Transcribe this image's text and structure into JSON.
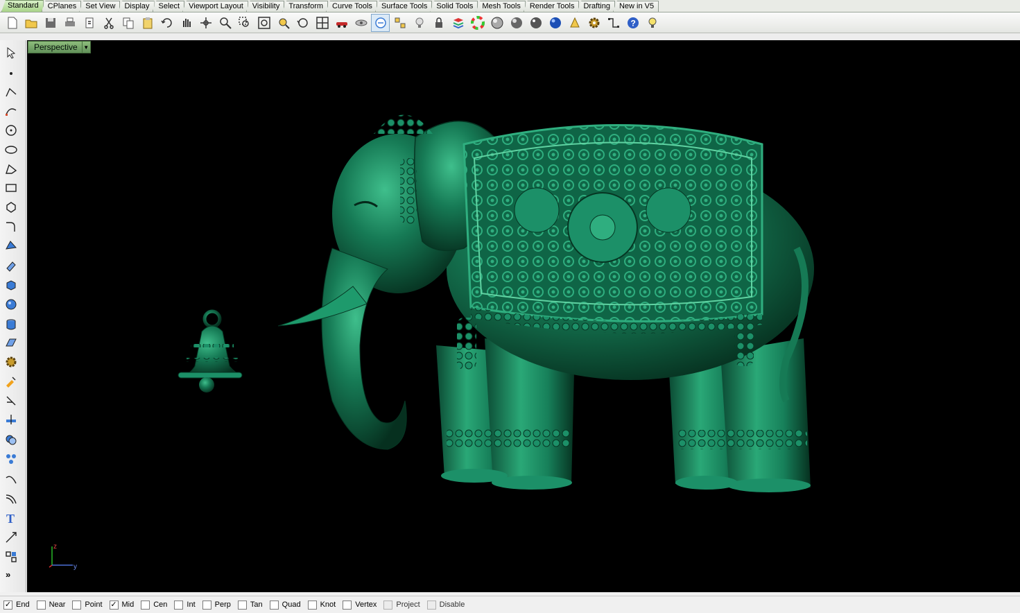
{
  "tabs": [
    "Standard",
    "CPlanes",
    "Set View",
    "Display",
    "Select",
    "Viewport Layout",
    "Visibility",
    "Transform",
    "Curve Tools",
    "Surface Tools",
    "Solid Tools",
    "Mesh Tools",
    "Render Tools",
    "Drafting",
    "New in V5"
  ],
  "active_tab": "Standard",
  "toolbar_icons": [
    "new-icon",
    "open-icon",
    "save-icon",
    "print-icon",
    "import-icon",
    "cut-icon",
    "copy-icon",
    "paste-icon",
    "undo-icon",
    "pan-icon",
    "rotate-view-icon",
    "zoom-icon",
    "zoom-window-icon",
    "zoom-extents-icon",
    "zoom-selected-icon",
    "undo-view-icon",
    "four-viewports-icon",
    "car-icon",
    "hide-icon",
    "osnap-icon",
    "point-edit-icon",
    "light-icon",
    "lock-icon",
    "layer-icon",
    "color-wheel-icon",
    "shaded-sphere-icon",
    "rendered-sphere-icon",
    "glossy-sphere-icon",
    "blue-sphere-icon",
    "analyze-icon",
    "settings-gear-icon",
    "dimension-icon",
    "help-icon",
    "lightbulb-icon"
  ],
  "left_tools": [
    "select-arrow-icon",
    "point-icon",
    "polyline-icon",
    "curve-icon",
    "circle-icon",
    "ellipse-icon",
    "arc-icon",
    "rectangle-icon",
    "polygon-icon",
    "fillet-curve-icon",
    "surface-icon",
    "extrude-icon",
    "box-icon",
    "sphere-icon",
    "cylinder-icon",
    "mesh-icon",
    "gear-tool-icon",
    "boolean-icon",
    "trim-icon",
    "split-icon",
    "boolean-union-icon",
    "group-icon",
    "offset-icon",
    "fillet-icon",
    "text-icon",
    "move-icon",
    "array-icon"
  ],
  "viewport": {
    "name": "Perspective",
    "axis_z": "z",
    "axis_y": "y",
    "model_color": "#167a55",
    "background": "#000000"
  },
  "osnaps": [
    {
      "label": "End",
      "checked": true,
      "enabled": true
    },
    {
      "label": "Near",
      "checked": false,
      "enabled": true
    },
    {
      "label": "Point",
      "checked": false,
      "enabled": true
    },
    {
      "label": "Mid",
      "checked": true,
      "enabled": true
    },
    {
      "label": "Cen",
      "checked": false,
      "enabled": true
    },
    {
      "label": "Int",
      "checked": false,
      "enabled": true
    },
    {
      "label": "Perp",
      "checked": false,
      "enabled": true
    },
    {
      "label": "Tan",
      "checked": false,
      "enabled": true
    },
    {
      "label": "Quad",
      "checked": false,
      "enabled": true
    },
    {
      "label": "Knot",
      "checked": false,
      "enabled": true
    },
    {
      "label": "Vertex",
      "checked": false,
      "enabled": true
    },
    {
      "label": "Project",
      "checked": false,
      "enabled": false
    },
    {
      "label": "Disable",
      "checked": false,
      "enabled": false
    }
  ],
  "more_tools_glyph": "»"
}
